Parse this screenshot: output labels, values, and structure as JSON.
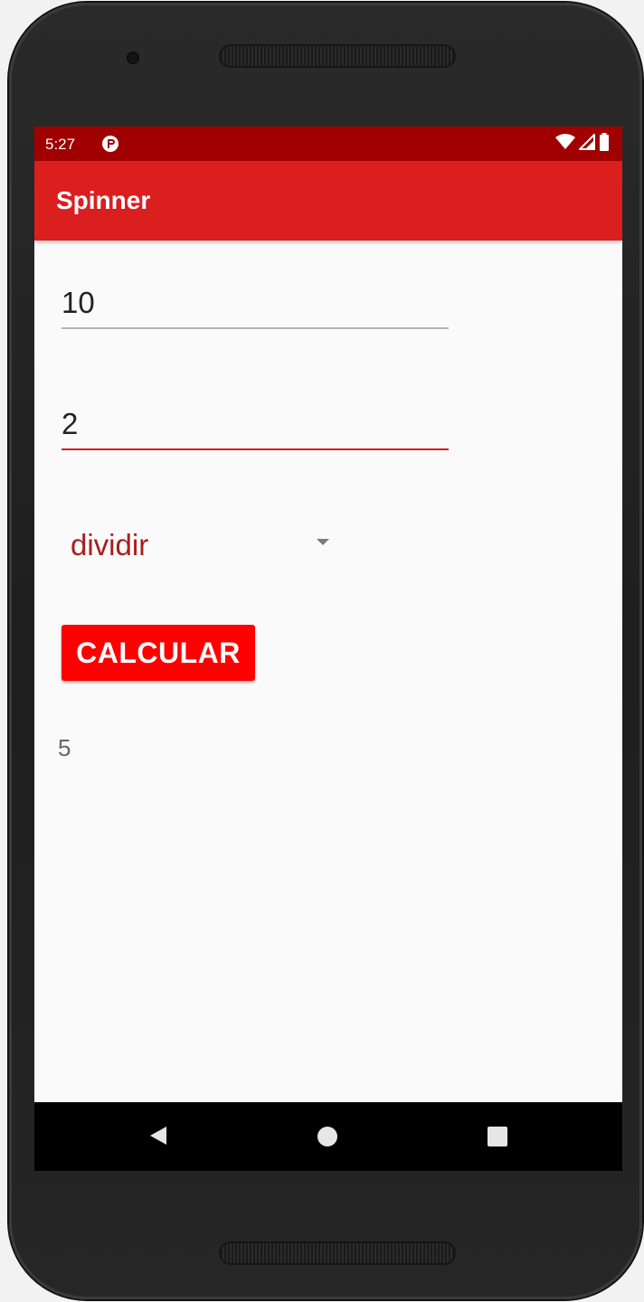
{
  "status_bar": {
    "time": "5:27",
    "notification_icon": "app-notification-icon",
    "icons": [
      "wifi-icon",
      "signal-icon",
      "battery-icon"
    ]
  },
  "app_bar": {
    "title": "Spinner"
  },
  "form": {
    "first_number": "10",
    "second_number": "2",
    "operation": "dividir",
    "calculate_label": "CALCULAR",
    "result": "5"
  },
  "nav_bar": {
    "icons": [
      "back-icon",
      "home-icon",
      "recents-icon"
    ]
  },
  "colors": {
    "status_bar": "#a00000",
    "app_bar": "#db1e1e",
    "accent": "#d81b1b",
    "button": "#ff0000",
    "spinner_text": "#a61f1f"
  }
}
